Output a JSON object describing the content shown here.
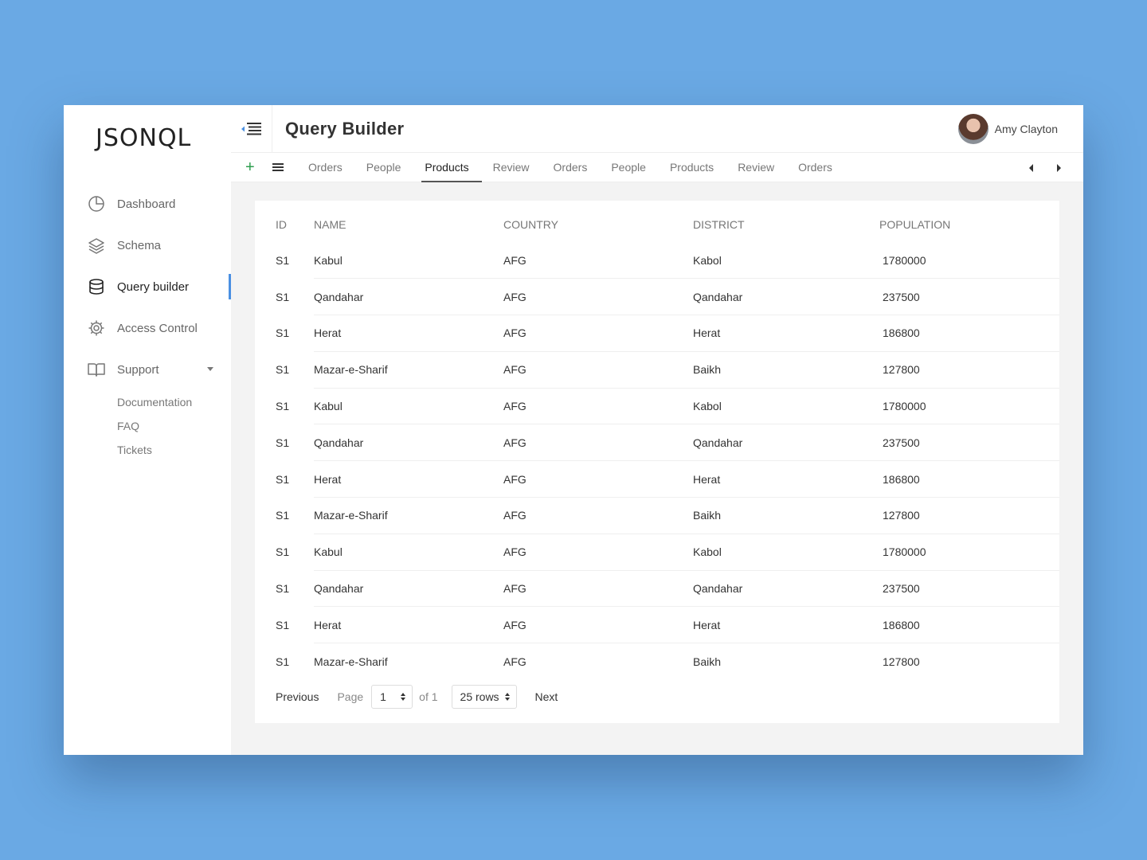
{
  "app": {
    "logo": "JSONQL"
  },
  "sidebar": {
    "items": [
      {
        "label": "Dashboard",
        "icon": "pie-chart-icon"
      },
      {
        "label": "Schema",
        "icon": "layers-icon"
      },
      {
        "label": "Query builder",
        "icon": "database-icon",
        "active": true
      },
      {
        "label": "Access Control",
        "icon": "gear-icon"
      },
      {
        "label": "Support",
        "icon": "book-icon"
      }
    ],
    "support_subitems": [
      "Documentation",
      "FAQ",
      "Tickets"
    ]
  },
  "header": {
    "title": "Query Builder",
    "user_name": "Amy Clayton"
  },
  "tabs": [
    "Orders",
    "People",
    "Products",
    "Review",
    "Orders",
    "People",
    "Products",
    "Review",
    "Orders"
  ],
  "active_tab_index": 2,
  "table": {
    "columns": [
      "ID",
      "NAME",
      "COUNTRY",
      "DISTRICT",
      "POPULATION"
    ],
    "rows": [
      [
        "S1",
        "Kabul",
        "AFG",
        "Kabol",
        "1780000"
      ],
      [
        "S1",
        "Qandahar",
        "AFG",
        "Qandahar",
        "237500"
      ],
      [
        "S1",
        "Herat",
        "AFG",
        "Herat",
        "186800"
      ],
      [
        "S1",
        "Mazar-e-Sharif",
        "AFG",
        "Baikh",
        "127800"
      ],
      [
        "S1",
        "Kabul",
        "AFG",
        "Kabol",
        "1780000"
      ],
      [
        "S1",
        "Qandahar",
        "AFG",
        "Qandahar",
        "237500"
      ],
      [
        "S1",
        "Herat",
        "AFG",
        "Herat",
        "186800"
      ],
      [
        "S1",
        "Mazar-e-Sharif",
        "AFG",
        "Baikh",
        "127800"
      ],
      [
        "S1",
        "Kabul",
        "AFG",
        "Kabol",
        "1780000"
      ],
      [
        "S1",
        "Qandahar",
        "AFG",
        "Qandahar",
        "237500"
      ],
      [
        "S1",
        "Herat",
        "AFG",
        "Herat",
        "186800"
      ],
      [
        "S1",
        "Mazar-e-Sharif",
        "AFG",
        "Baikh",
        "127800"
      ]
    ]
  },
  "pagination": {
    "previous_label": "Previous",
    "page_label": "Page",
    "page_value": "1",
    "of_label": "of 1",
    "rows_value": "25 rows",
    "next_label": "Next"
  },
  "colors": {
    "background": "#6aa9e4",
    "accent": "#4a90e2",
    "add": "#2e9e4f"
  }
}
